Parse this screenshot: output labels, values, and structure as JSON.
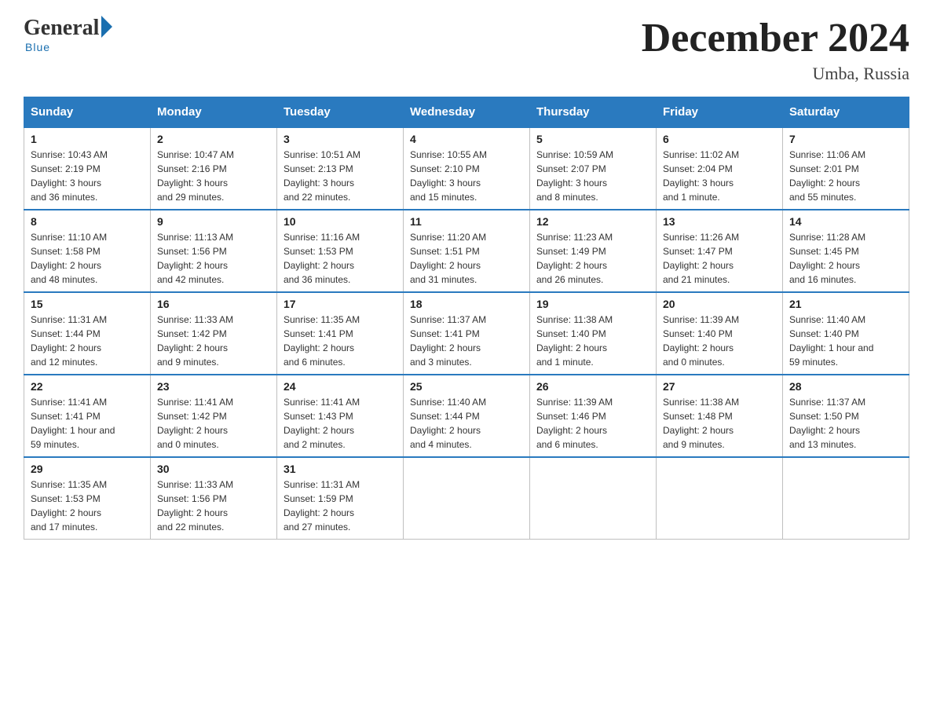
{
  "logo": {
    "general": "General",
    "blue": "Blue",
    "tagline": "Blue"
  },
  "title": "December 2024",
  "subtitle": "Umba, Russia",
  "weekdays": [
    "Sunday",
    "Monday",
    "Tuesday",
    "Wednesday",
    "Thursday",
    "Friday",
    "Saturday"
  ],
  "weeks": [
    [
      {
        "day": "1",
        "info": "Sunrise: 10:43 AM\nSunset: 2:19 PM\nDaylight: 3 hours\nand 36 minutes."
      },
      {
        "day": "2",
        "info": "Sunrise: 10:47 AM\nSunset: 2:16 PM\nDaylight: 3 hours\nand 29 minutes."
      },
      {
        "day": "3",
        "info": "Sunrise: 10:51 AM\nSunset: 2:13 PM\nDaylight: 3 hours\nand 22 minutes."
      },
      {
        "day": "4",
        "info": "Sunrise: 10:55 AM\nSunset: 2:10 PM\nDaylight: 3 hours\nand 15 minutes."
      },
      {
        "day": "5",
        "info": "Sunrise: 10:59 AM\nSunset: 2:07 PM\nDaylight: 3 hours\nand 8 minutes."
      },
      {
        "day": "6",
        "info": "Sunrise: 11:02 AM\nSunset: 2:04 PM\nDaylight: 3 hours\nand 1 minute."
      },
      {
        "day": "7",
        "info": "Sunrise: 11:06 AM\nSunset: 2:01 PM\nDaylight: 2 hours\nand 55 minutes."
      }
    ],
    [
      {
        "day": "8",
        "info": "Sunrise: 11:10 AM\nSunset: 1:58 PM\nDaylight: 2 hours\nand 48 minutes."
      },
      {
        "day": "9",
        "info": "Sunrise: 11:13 AM\nSunset: 1:56 PM\nDaylight: 2 hours\nand 42 minutes."
      },
      {
        "day": "10",
        "info": "Sunrise: 11:16 AM\nSunset: 1:53 PM\nDaylight: 2 hours\nand 36 minutes."
      },
      {
        "day": "11",
        "info": "Sunrise: 11:20 AM\nSunset: 1:51 PM\nDaylight: 2 hours\nand 31 minutes."
      },
      {
        "day": "12",
        "info": "Sunrise: 11:23 AM\nSunset: 1:49 PM\nDaylight: 2 hours\nand 26 minutes."
      },
      {
        "day": "13",
        "info": "Sunrise: 11:26 AM\nSunset: 1:47 PM\nDaylight: 2 hours\nand 21 minutes."
      },
      {
        "day": "14",
        "info": "Sunrise: 11:28 AM\nSunset: 1:45 PM\nDaylight: 2 hours\nand 16 minutes."
      }
    ],
    [
      {
        "day": "15",
        "info": "Sunrise: 11:31 AM\nSunset: 1:44 PM\nDaylight: 2 hours\nand 12 minutes."
      },
      {
        "day": "16",
        "info": "Sunrise: 11:33 AM\nSunset: 1:42 PM\nDaylight: 2 hours\nand 9 minutes."
      },
      {
        "day": "17",
        "info": "Sunrise: 11:35 AM\nSunset: 1:41 PM\nDaylight: 2 hours\nand 6 minutes."
      },
      {
        "day": "18",
        "info": "Sunrise: 11:37 AM\nSunset: 1:41 PM\nDaylight: 2 hours\nand 3 minutes."
      },
      {
        "day": "19",
        "info": "Sunrise: 11:38 AM\nSunset: 1:40 PM\nDaylight: 2 hours\nand 1 minute."
      },
      {
        "day": "20",
        "info": "Sunrise: 11:39 AM\nSunset: 1:40 PM\nDaylight: 2 hours\nand 0 minutes."
      },
      {
        "day": "21",
        "info": "Sunrise: 11:40 AM\nSunset: 1:40 PM\nDaylight: 1 hour and\n59 minutes."
      }
    ],
    [
      {
        "day": "22",
        "info": "Sunrise: 11:41 AM\nSunset: 1:41 PM\nDaylight: 1 hour and\n59 minutes."
      },
      {
        "day": "23",
        "info": "Sunrise: 11:41 AM\nSunset: 1:42 PM\nDaylight: 2 hours\nand 0 minutes."
      },
      {
        "day": "24",
        "info": "Sunrise: 11:41 AM\nSunset: 1:43 PM\nDaylight: 2 hours\nand 2 minutes."
      },
      {
        "day": "25",
        "info": "Sunrise: 11:40 AM\nSunset: 1:44 PM\nDaylight: 2 hours\nand 4 minutes."
      },
      {
        "day": "26",
        "info": "Sunrise: 11:39 AM\nSunset: 1:46 PM\nDaylight: 2 hours\nand 6 minutes."
      },
      {
        "day": "27",
        "info": "Sunrise: 11:38 AM\nSunset: 1:48 PM\nDaylight: 2 hours\nand 9 minutes."
      },
      {
        "day": "28",
        "info": "Sunrise: 11:37 AM\nSunset: 1:50 PM\nDaylight: 2 hours\nand 13 minutes."
      }
    ],
    [
      {
        "day": "29",
        "info": "Sunrise: 11:35 AM\nSunset: 1:53 PM\nDaylight: 2 hours\nand 17 minutes."
      },
      {
        "day": "30",
        "info": "Sunrise: 11:33 AM\nSunset: 1:56 PM\nDaylight: 2 hours\nand 22 minutes."
      },
      {
        "day": "31",
        "info": "Sunrise: 11:31 AM\nSunset: 1:59 PM\nDaylight: 2 hours\nand 27 minutes."
      },
      null,
      null,
      null,
      null
    ]
  ]
}
